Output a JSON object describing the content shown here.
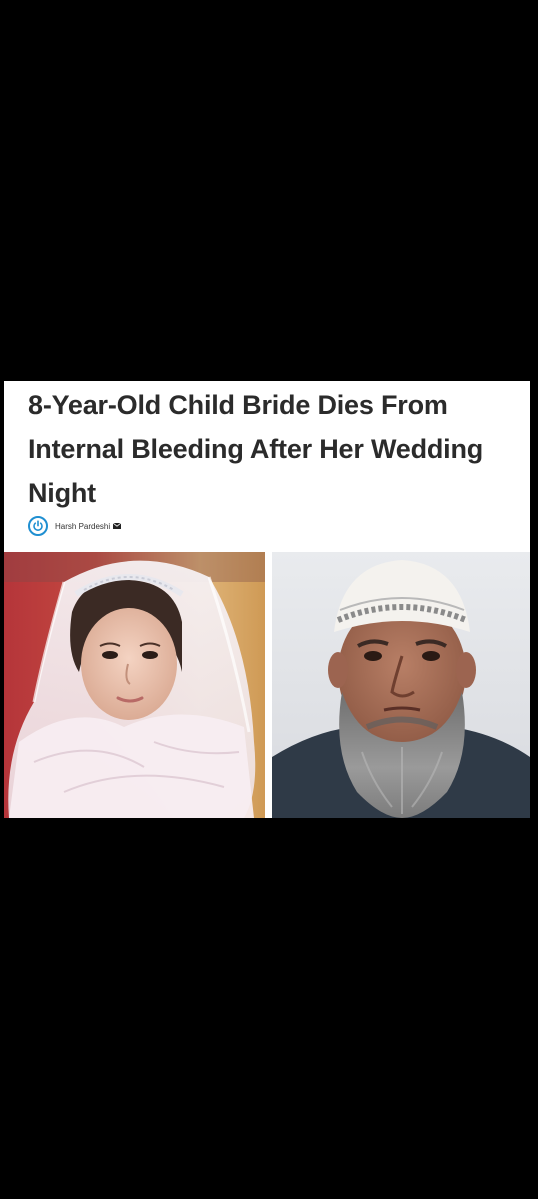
{
  "article": {
    "headline": "8-Year-Old Child Bride Dies From Internal Bleeding After Her Wedding Night",
    "author": "Harsh Pardeshi"
  },
  "icons": {
    "site_logo": "power-icon",
    "author_contact": "mail-icon"
  },
  "colors": {
    "background": "#000000",
    "card": "#ffffff",
    "headline_text": "#2b2b2b",
    "logo_accent": "#1f8fd1"
  }
}
